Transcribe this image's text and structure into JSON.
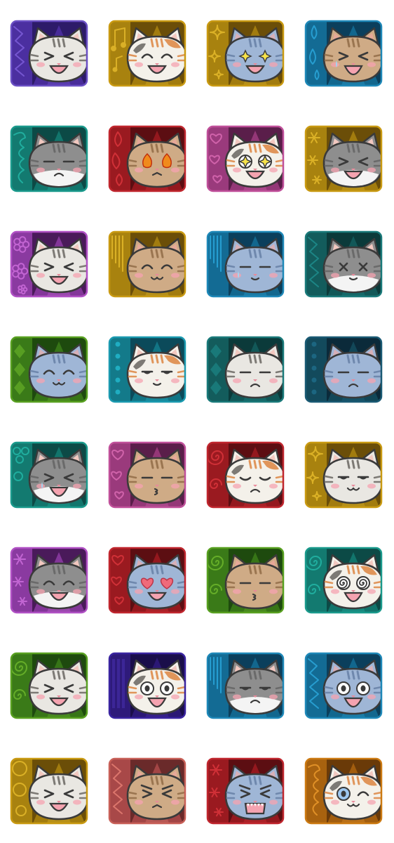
{
  "stickers": [
    {
      "bg": "purple",
      "fur": "tabby",
      "emotion": "laugh",
      "deco": "zigzag"
    },
    {
      "bg": "gold",
      "fur": "calico",
      "emotion": "joy",
      "deco": "music-notes"
    },
    {
      "bg": "gold",
      "fur": "blue",
      "emotion": "star-eyes",
      "deco": "sparkles"
    },
    {
      "bg": "blue",
      "fur": "brown",
      "emotion": "cry",
      "deco": "drops"
    },
    {
      "bg": "teal",
      "fur": "gray-white",
      "emotion": "frown",
      "deco": "scribble"
    },
    {
      "bg": "red",
      "fur": "brown",
      "emotion": "fire-eyes",
      "deco": "flames"
    },
    {
      "bg": "pink",
      "fur": "calico",
      "emotion": "sparkle-eyes",
      "deco": "hearts"
    },
    {
      "bg": "gold",
      "fur": "gray-white",
      "emotion": "laugh",
      "deco": "asterisks"
    },
    {
      "bg": "magenta",
      "fur": "tabby",
      "emotion": "giggle",
      "deco": "flowers"
    },
    {
      "bg": "gold",
      "fur": "brown",
      "emotion": "content",
      "deco": "lines"
    },
    {
      "bg": "blue",
      "fur": "blue",
      "emotion": "sleepy",
      "deco": "lines"
    },
    {
      "bg": "dark-teal",
      "fur": "gray-white",
      "emotion": "dizzy-x",
      "deco": "zigzag"
    },
    {
      "bg": "green",
      "fur": "blue",
      "emotion": "smug",
      "deco": "diamonds"
    },
    {
      "bg": "cyan",
      "fur": "calico",
      "emotion": "unimpressed",
      "deco": "dots"
    },
    {
      "bg": "dark-teal",
      "fur": "tabby",
      "emotion": "pout",
      "deco": "diamonds"
    },
    {
      "bg": "navy",
      "fur": "blue",
      "emotion": "annoyed",
      "deco": "dots"
    },
    {
      "bg": "teal",
      "fur": "gray-white",
      "emotion": "wail",
      "deco": "bubbles"
    },
    {
      "bg": "pink",
      "fur": "brown",
      "emotion": "kiss",
      "deco": "hearts"
    },
    {
      "bg": "red",
      "fur": "calico",
      "emotion": "sad",
      "deco": "swirls"
    },
    {
      "bg": "gold",
      "fur": "tabby",
      "emotion": "smirk",
      "deco": "sparkles"
    },
    {
      "bg": "magenta",
      "fur": "gray-white",
      "emotion": "grin",
      "deco": "asterisks"
    },
    {
      "bg": "red",
      "fur": "blue",
      "emotion": "heart-eyes",
      "deco": "hearts"
    },
    {
      "bg": "green",
      "fur": "brown",
      "emotion": "kiss",
      "deco": "spiral"
    },
    {
      "bg": "teal",
      "fur": "calico",
      "emotion": "dizzy",
      "deco": "spiral"
    },
    {
      "bg": "green",
      "fur": "tabby",
      "emotion": "laugh",
      "deco": "spiral"
    },
    {
      "bg": "indigo",
      "fur": "calico",
      "emotion": "shock",
      "deco": "bars"
    },
    {
      "bg": "blue",
      "fur": "gray-white",
      "emotion": "grumpy",
      "deco": "lines"
    },
    {
      "bg": "blue",
      "fur": "blue",
      "emotion": "shock",
      "deco": "zigzag"
    },
    {
      "bg": "gold",
      "fur": "tabby",
      "emotion": "laugh",
      "deco": "circles"
    },
    {
      "bg": "salmon",
      "fur": "brown",
      "emotion": "angry",
      "deco": "zigzag"
    },
    {
      "bg": "red",
      "fur": "blue",
      "emotion": "rage",
      "deco": "asterisks"
    },
    {
      "bg": "orange",
      "fur": "calico",
      "emotion": "wink",
      "deco": "scribble"
    }
  ],
  "palette": {
    "purple": {
      "dark": "#2d1b69",
      "mid": "#4b2fa0",
      "light": "#7a5bd6",
      "border": "#6a4fc4"
    },
    "gold": {
      "dark": "#6b4e08",
      "mid": "#a8820f",
      "light": "#e0b62a",
      "border": "#c99a12"
    },
    "blue": {
      "dark": "#0b3f5c",
      "mid": "#136b94",
      "light": "#2aa3d6",
      "border": "#1e88b8"
    },
    "teal": {
      "dark": "#0c4a46",
      "mid": "#137a70",
      "light": "#22b3a3",
      "border": "#1a9a8c"
    },
    "red": {
      "dark": "#5c0e12",
      "mid": "#9a1a20",
      "light": "#d6333a",
      "border": "#c0262e"
    },
    "pink": {
      "dark": "#5a1e4a",
      "mid": "#9a3a7c",
      "light": "#d668b0",
      "border": "#c0509a"
    },
    "magenta": {
      "dark": "#4a1a5a",
      "mid": "#8a3aa0",
      "light": "#c86ad8",
      "border": "#b050c4"
    },
    "dark-teal": {
      "dark": "#0b3a3a",
      "mid": "#135c5c",
      "light": "#1e8a8a",
      "border": "#1a7a7a"
    },
    "green": {
      "dark": "#1e4a0e",
      "mid": "#3a7a18",
      "light": "#6ab32a",
      "border": "#58a020"
    },
    "cyan": {
      "dark": "#0b4a5a",
      "mid": "#137a8a",
      "light": "#22b3c8",
      "border": "#1a9ab0"
    },
    "navy": {
      "dark": "#0b2a3a",
      "mid": "#134a5c",
      "light": "#1e6a86",
      "border": "#1a5a74"
    },
    "indigo": {
      "dark": "#1a0e4a",
      "mid": "#2e1a7a",
      "light": "#4a30b0",
      "border": "#3a24a0"
    },
    "salmon": {
      "dark": "#6a2a2a",
      "mid": "#a84848",
      "light": "#e07a70",
      "border": "#c86058"
    },
    "orange": {
      "dark": "#6a3a08",
      "mid": "#a8620f",
      "light": "#e6962a",
      "border": "#cc7a12"
    }
  },
  "fur_colors": {
    "tabby": {
      "base": "#e9e7e2",
      "stripe": "#7d7a75",
      "ear": "#f2c8c0"
    },
    "calico": {
      "base": "#f4f1ea",
      "stripe": "#e0955a",
      "ear": "#f2c8c0"
    },
    "blue": {
      "base": "#9fb6d6",
      "stripe": "#6f88ad",
      "ear": "#d6b0b8"
    },
    "brown": {
      "base": "#cfab86",
      "stripe": "#9a7550",
      "ear": "#e6a898"
    },
    "gray-white": {
      "base": "#8e8e8e",
      "stripe": "#6a6a6a",
      "ear": "#f2c8c0"
    }
  }
}
